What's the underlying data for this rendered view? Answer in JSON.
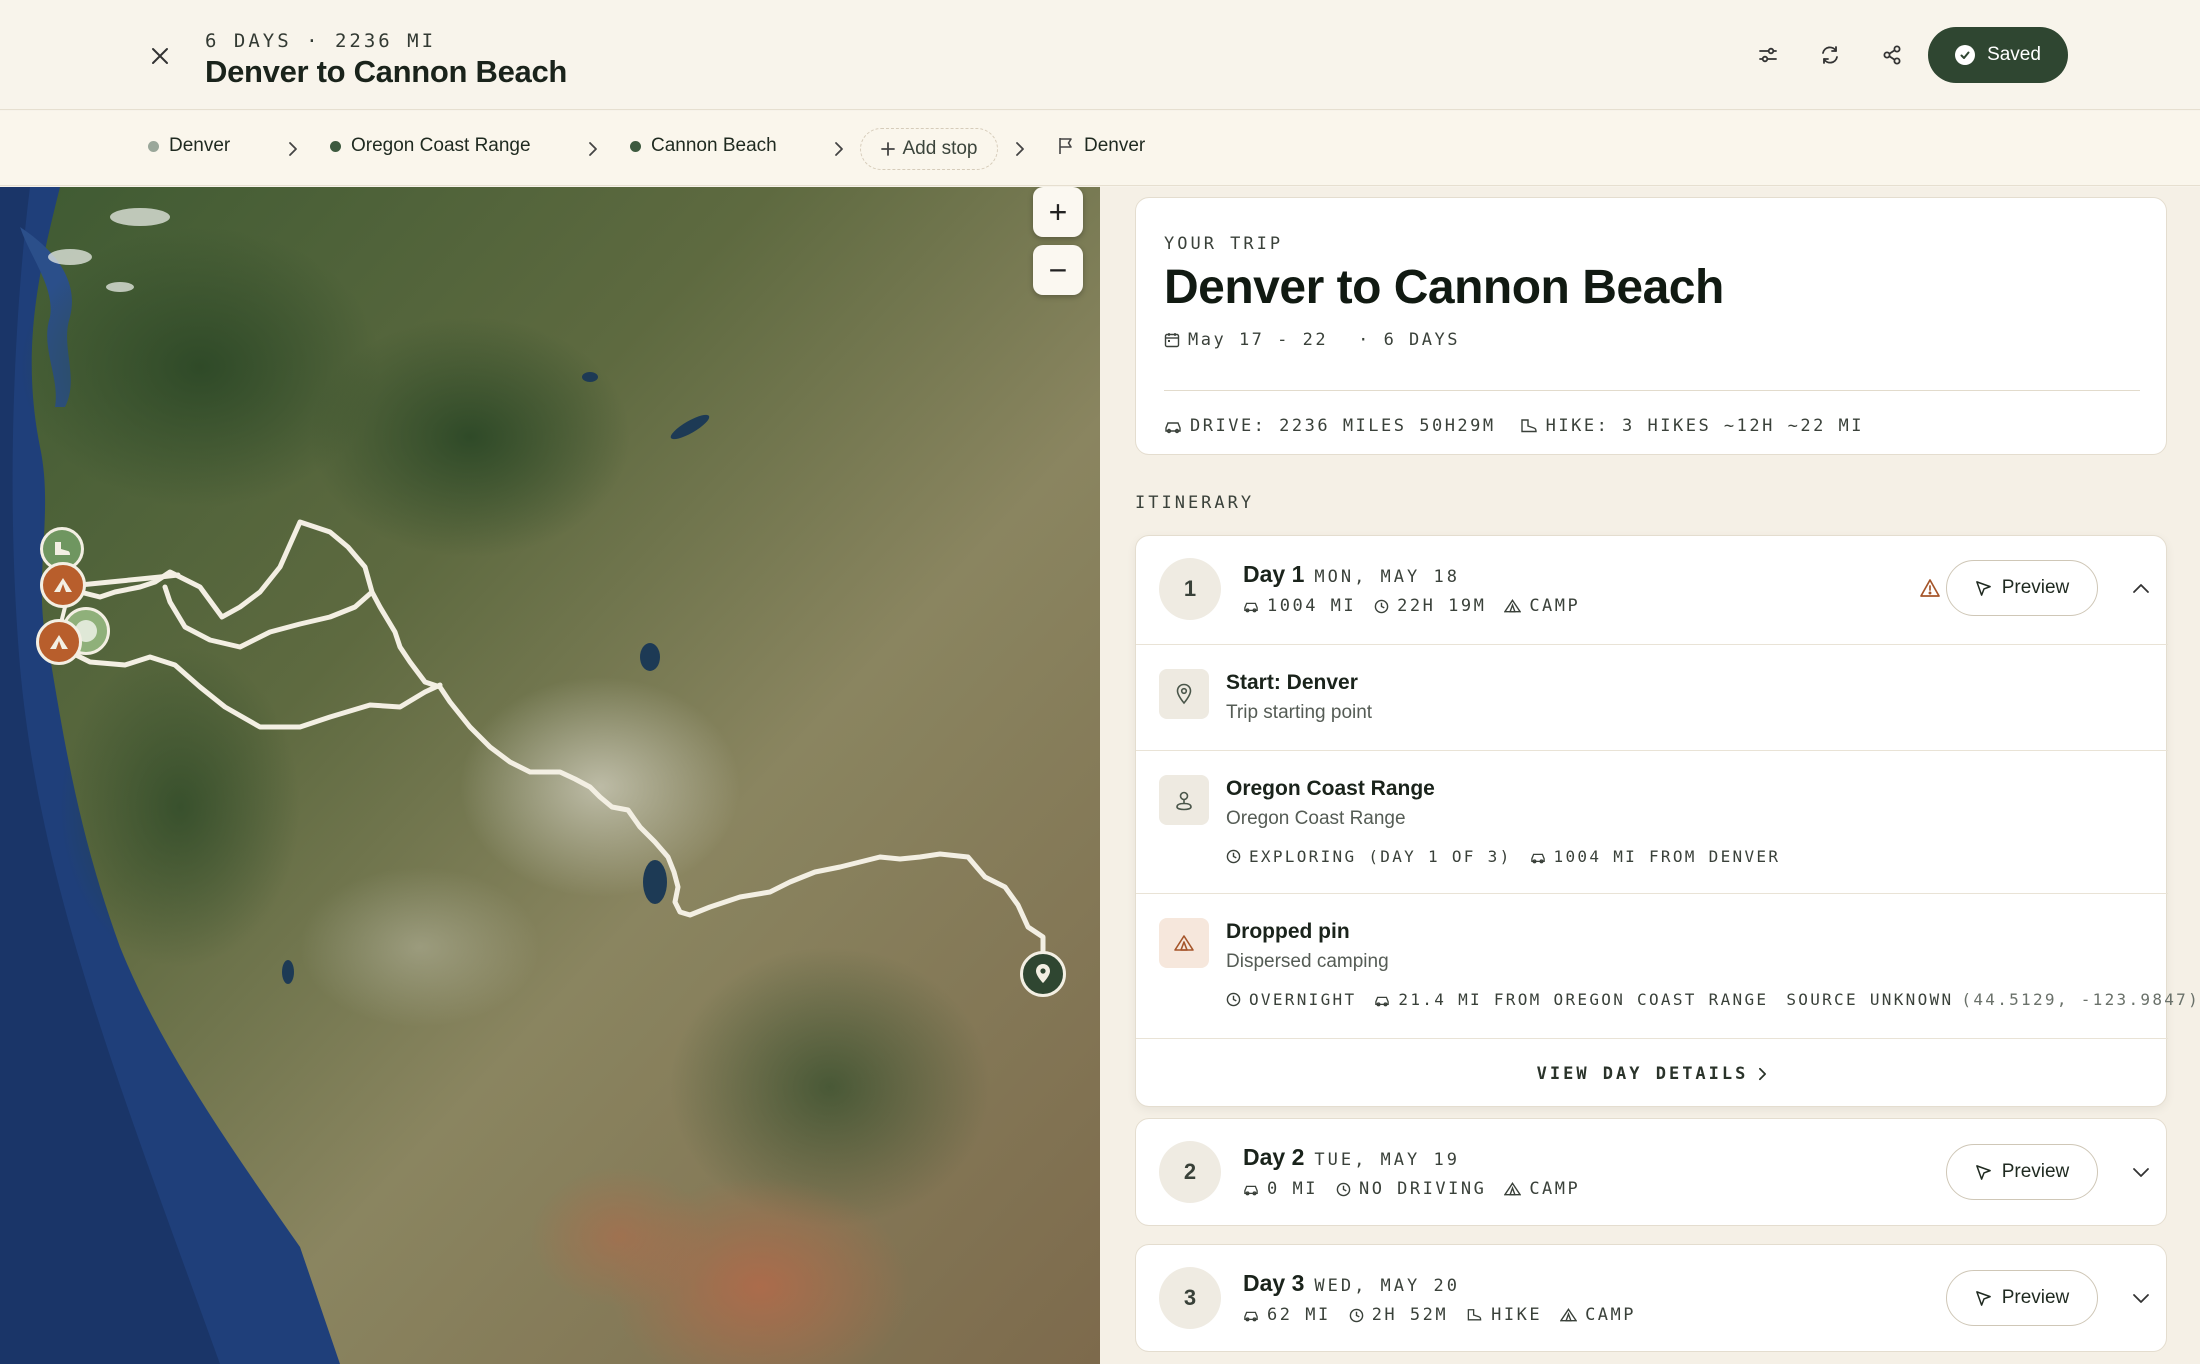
{
  "header": {
    "meta": "6 DAYS · 2236 MI",
    "title": "Denver to Cannon Beach",
    "saved_label": "Saved"
  },
  "stops_bar": {
    "stops": [
      {
        "label": "Denver",
        "color": "#9aa79a"
      },
      {
        "label": "Oregon Coast Range",
        "color": "#3d5a3f"
      },
      {
        "label": "Cannon Beach",
        "color": "#3d5a3f"
      }
    ],
    "add_stop_label": "Add stop",
    "end_label": "Denver"
  },
  "map": {
    "zoom_in": "+",
    "zoom_out": "−"
  },
  "trip": {
    "label": "YOUR TRIP",
    "title": "Denver to Cannon Beach",
    "dates": "May 17 - 22",
    "days": "· 6 DAYS",
    "drive": "DRIVE: 2236 MILES 50H29M",
    "hike": "HIKE: 3 HIKES ~12H ~22 MI"
  },
  "itinerary": {
    "label": "ITINERARY",
    "preview_label": "Preview",
    "view_details": "VIEW DAY DETAILS",
    "days": [
      {
        "num": "1",
        "name": "Day 1",
        "date": "MON, MAY 18",
        "distance": "1004 MI",
        "time": "22H 19M",
        "camp": "CAMP",
        "stops": [
          {
            "name": "Start: Denver",
            "sub": "Trip starting point"
          },
          {
            "name": "Oregon Coast Range",
            "sub": "Oregon Coast Range",
            "meta1": "EXPLORING (DAY 1 OF 3)",
            "meta2": "1004 MI FROM DENVER"
          },
          {
            "name": "Dropped pin",
            "sub": "Dispersed camping",
            "meta1": "OVERNIGHT",
            "meta2": "21.4 MI FROM OREGON COAST RANGE",
            "meta3": "SOURCE UNKNOWN",
            "meta4": "(44.5129, -123.9847)"
          }
        ]
      },
      {
        "num": "2",
        "name": "Day 2",
        "date": "TUE, MAY 19",
        "distance": "0 MI",
        "time": "NO DRIVING",
        "camp": "CAMP"
      },
      {
        "num": "3",
        "name": "Day 3",
        "date": "WED, MAY 20",
        "distance": "62 MI",
        "time": "2H 52M",
        "hike": "HIKE",
        "camp": "CAMP"
      }
    ]
  }
}
